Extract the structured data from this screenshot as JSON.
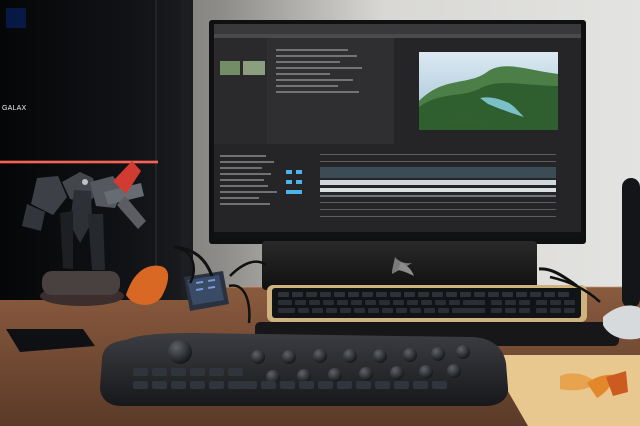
{
  "scene": {
    "pc_case_brand": "GALAX",
    "colors": {
      "wall": "#d8d8d4",
      "desk": "#6b4631",
      "monitor": "#121214",
      "screen_panel": "#2f2f31",
      "accent_orange": "#d06a1f",
      "mat_yellow": "#e4c18a"
    }
  }
}
